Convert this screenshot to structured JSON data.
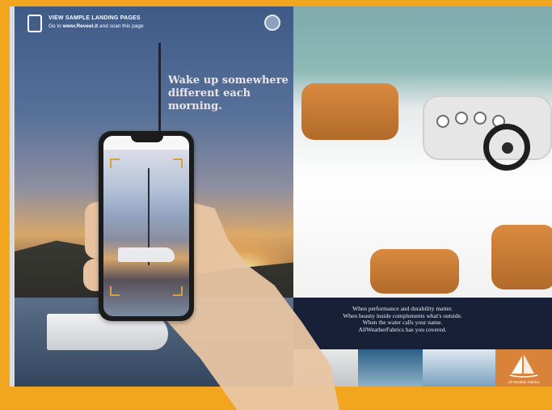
{
  "instruction_banner": {
    "title": "VIEW SAMPLE LANDING PAGES",
    "prefix": "Go to",
    "url": "www.Reveel.it",
    "suffix": "and scan this page"
  },
  "left_page": {
    "headline_line1": "Wake up somewhere",
    "headline_line2": "different each morning."
  },
  "right_page": {
    "caption_lines": [
      "When performance and durability matter.",
      "When beauty inside complements what's outside.",
      "When the water calls your name.",
      "AllWeatherFabrics has you covered."
    ],
    "brand_tile_text": "All Weather Fabrics"
  },
  "colors": {
    "background": "#f2a51f",
    "caption_band": "#172036",
    "brand_tile": "#d8823a"
  },
  "icons": [
    "phone-scan-icon",
    "seal-badge-icon",
    "sail-logo-icon"
  ]
}
